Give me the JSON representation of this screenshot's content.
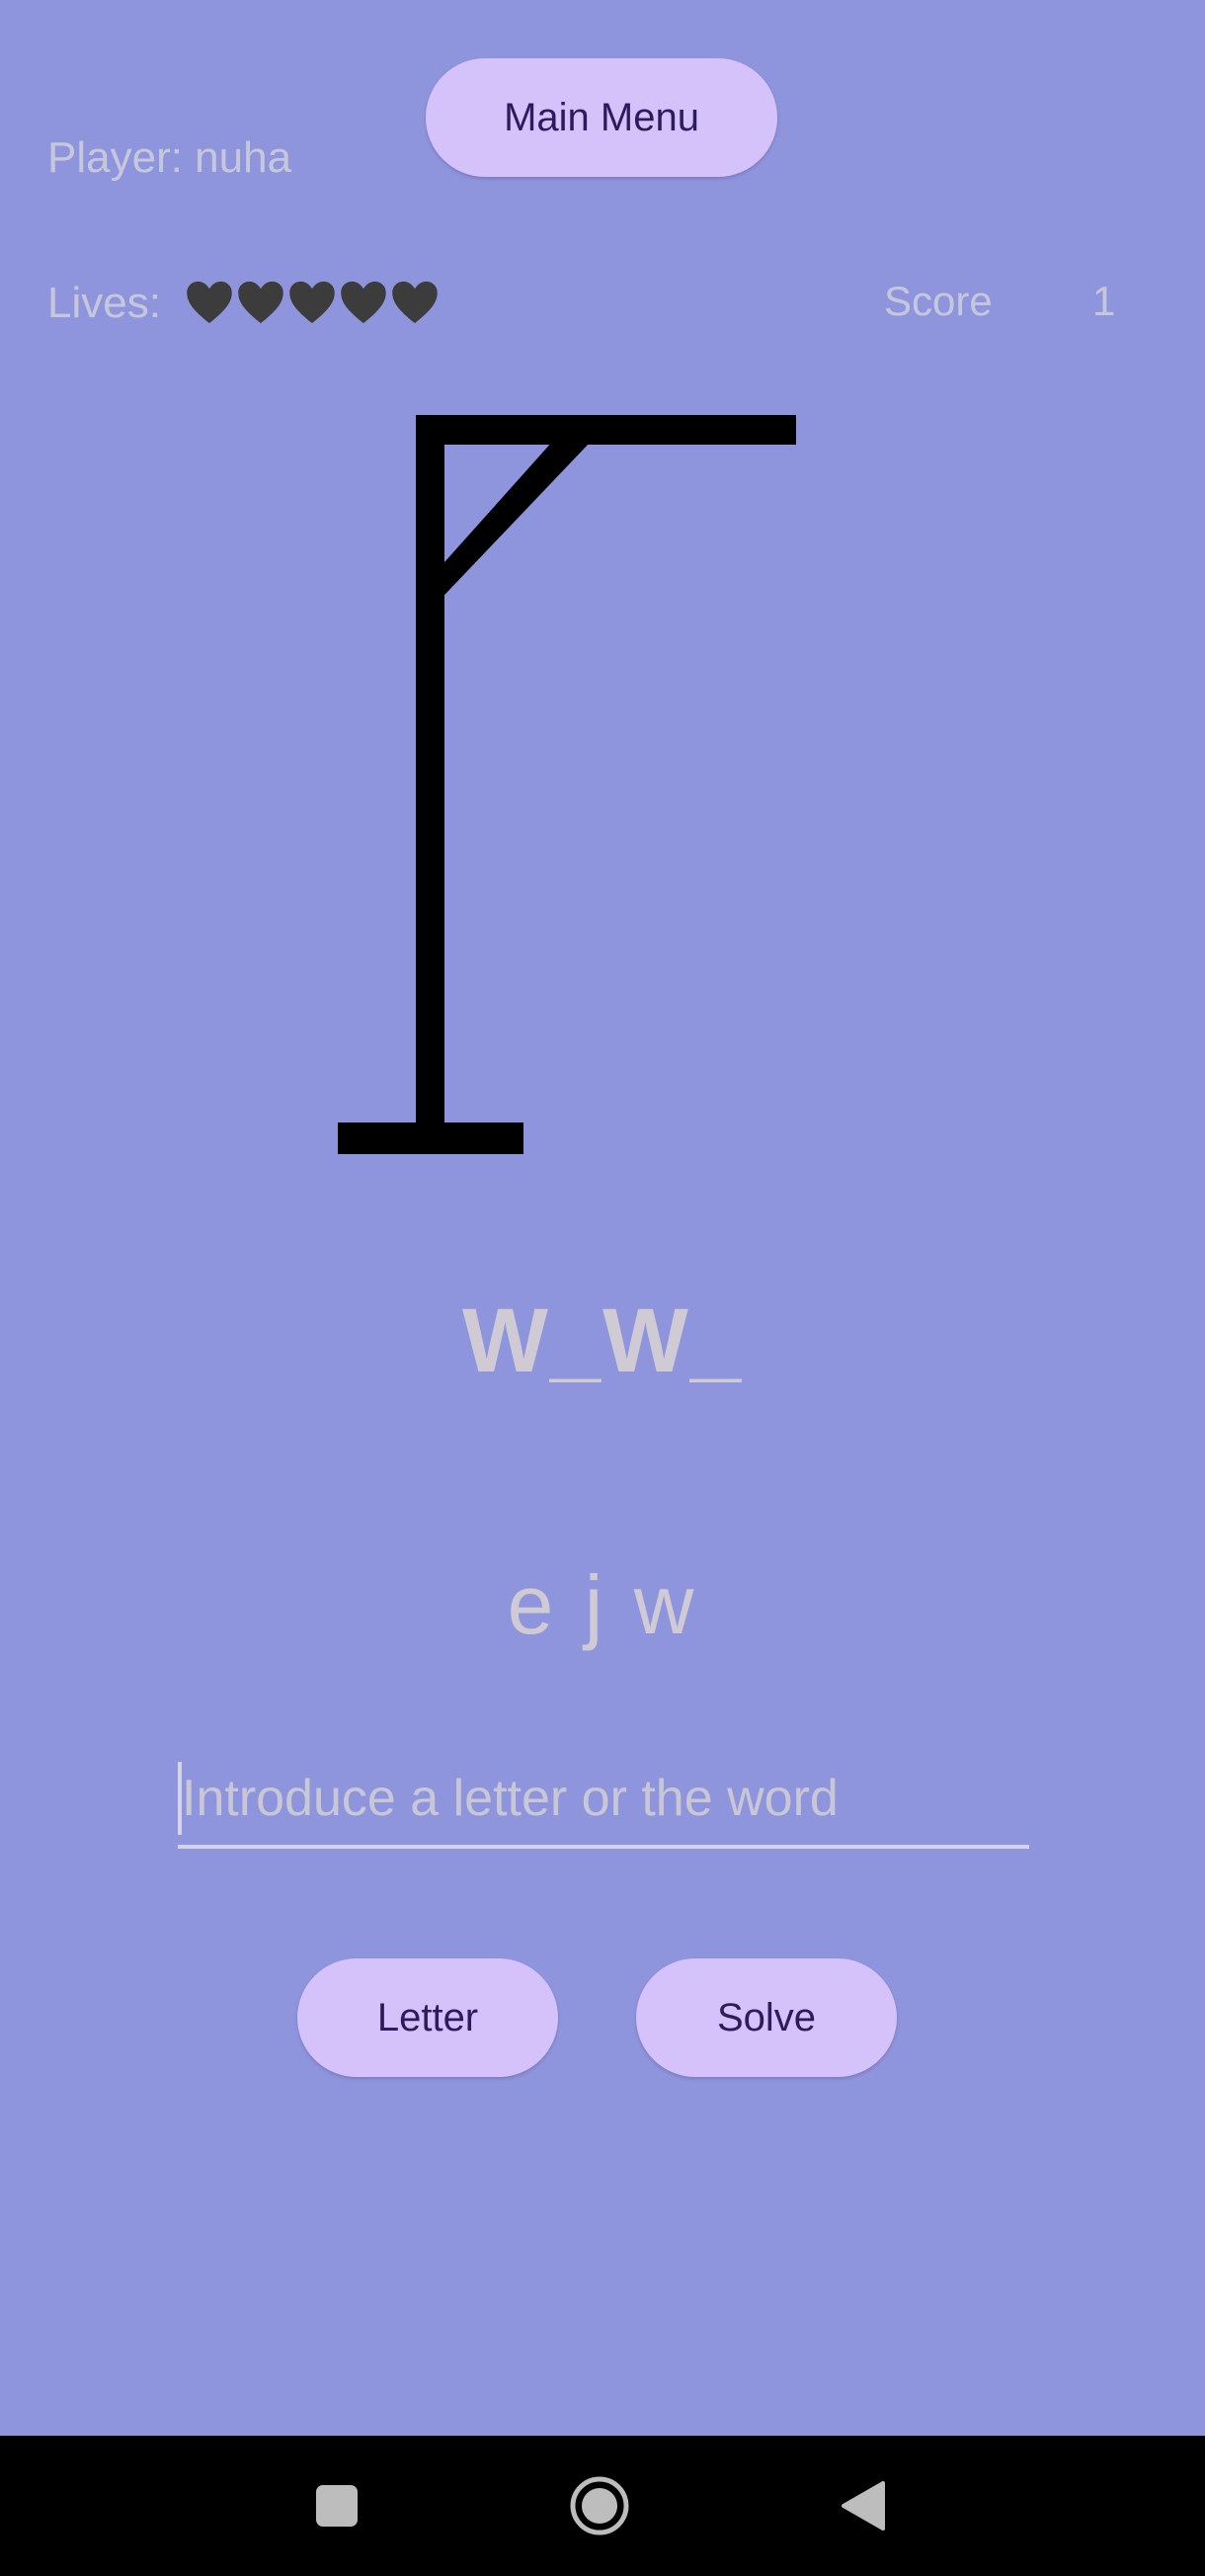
{
  "header": {
    "main_menu_label": "Main Menu",
    "player_label": "Player: nuha"
  },
  "stats": {
    "lives_label": "Lives:",
    "lives_count": 5,
    "heart_icon": "black-heart-icon",
    "score_label": "Score",
    "score_value": "1"
  },
  "game": {
    "masked_word": "W_W_",
    "guessed_letters": "e j w"
  },
  "input": {
    "placeholder": "Introduce a letter or the word",
    "value": ""
  },
  "actions": {
    "letter_label": "Letter",
    "solve_label": "Solve"
  },
  "nav": {
    "icons": [
      "recent-apps-icon",
      "home-icon",
      "back-icon"
    ]
  },
  "colors": {
    "background": "#8f95dc",
    "button_bg": "#d5c2fb",
    "button_text": "#2e1b5e",
    "muted_text": "#c7c7dc"
  }
}
